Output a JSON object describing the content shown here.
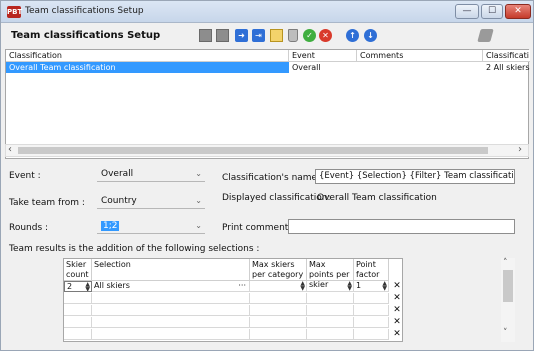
{
  "window": {
    "title": "Team classifications Setup",
    "app_icon_text": "PBT",
    "minimize": "—",
    "maximize": "☐",
    "close": "✕"
  },
  "toolbar": {
    "title": "Team classifications Setup"
  },
  "grid": {
    "columns": [
      "Classification",
      "Event",
      "Comments",
      "Classificati"
    ],
    "rows": [
      {
        "classification": "Overall Team classification",
        "event": "Overall",
        "comments": "",
        "classificati": "2 All skiers"
      }
    ]
  },
  "form": {
    "event_label": "Event :",
    "event_value": "Overall",
    "take_team_label": "Take team from :",
    "take_team_value": "Country",
    "rounds_label": "Rounds :",
    "rounds_value": "1;2",
    "class_name_label": "Classification's name :",
    "class_name_value": "{Event} {Selection} {Filter} Team classification",
    "displayed_label": "Displayed classification:",
    "displayed_value": "Overall Team classification",
    "print_comments_label": "Print comments :",
    "print_comments_value": ""
  },
  "selections": {
    "caption": "Team results is the addition of the following selections :",
    "headers": [
      "Skier count",
      "Selection",
      "Max skiers per category",
      "Max points per skier",
      "Point factor"
    ],
    "rows": [
      {
        "skier_count": "2",
        "selection": "All skiers",
        "max_skiers": "",
        "max_points": "",
        "point_factor": "1"
      }
    ],
    "empty_rows": 4,
    "delete_glyph": "✕",
    "ellipsis": "···"
  }
}
